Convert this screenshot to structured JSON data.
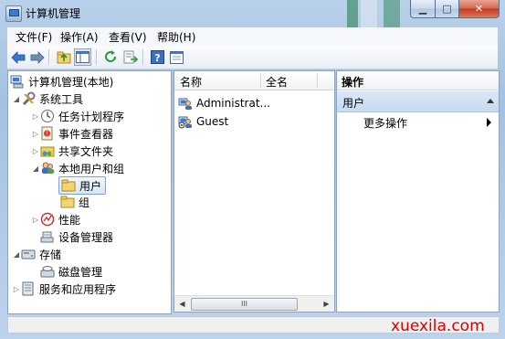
{
  "window": {
    "title": "计算机管理"
  },
  "menubar": {
    "items": [
      "文件(F)",
      "操作(A)",
      "查看(V)",
      "帮助(H)"
    ]
  },
  "toolbar": {
    "icons": [
      "back-arrow-icon",
      "forward-arrow-icon",
      "up-folder-icon",
      "show-hide-tree-icon",
      "refresh-icon",
      "export-list-icon",
      "help-icon",
      "properties-icon"
    ]
  },
  "tree": {
    "root": "计算机管理(本地)",
    "system_tools": "系统工具",
    "task_scheduler": "任务计划程序",
    "event_viewer": "事件查看器",
    "shared_folders": "共享文件夹",
    "local_users_groups": "本地用户和组",
    "users": "用户",
    "groups": "组",
    "performance": "性能",
    "device_manager": "设备管理器",
    "storage": "存储",
    "disk_management": "磁盘管理",
    "services_apps": "服务和应用程序"
  },
  "list": {
    "columns": [
      "名称",
      "全名"
    ],
    "rows": [
      {
        "name": "Administrat..."
      },
      {
        "name": "Guest"
      }
    ],
    "scroll_thumb": "III"
  },
  "actions": {
    "header": "操作",
    "section": "用户",
    "items": [
      "更多操作"
    ]
  },
  "watermark": "xuexila.com",
  "colors": {
    "selection": "#d8e6f8",
    "accent": "#3a7bd5",
    "watermark": "#d80000"
  }
}
